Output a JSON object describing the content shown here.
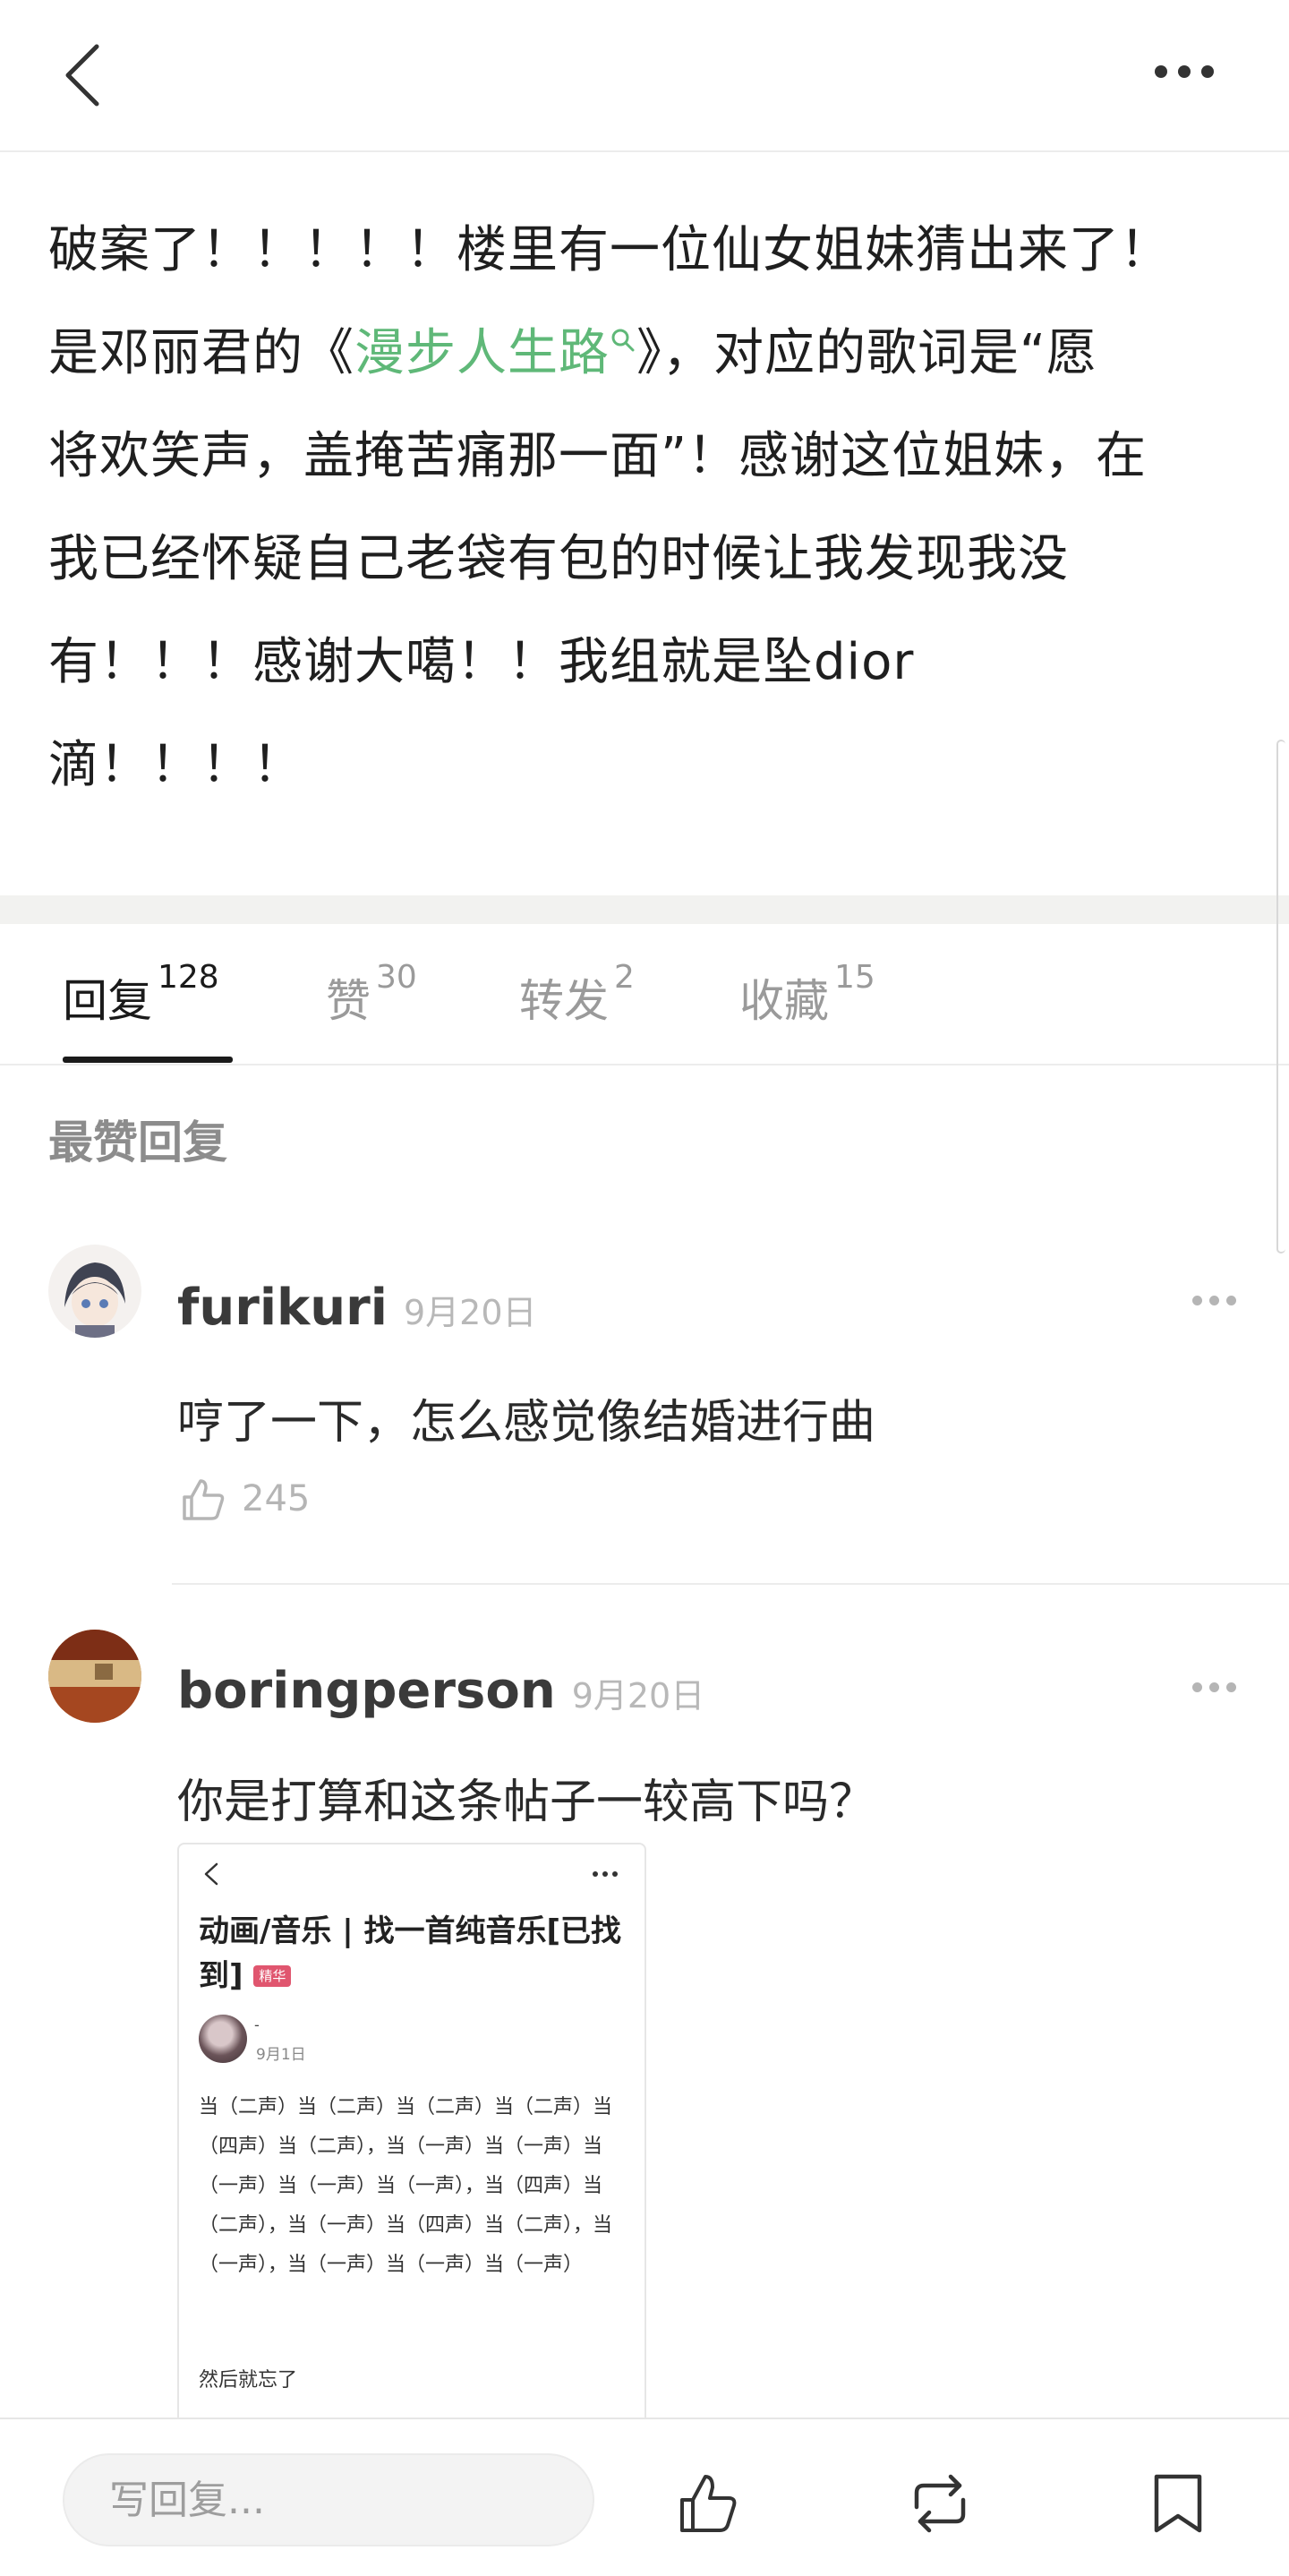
{
  "post": {
    "line1": "破案了！！！！！楼里有一位仙女姐妹猜出来了！",
    "line2_prefix": "是邓丽君的《",
    "line2_link": "漫步人生路",
    "line2_suffix": "》，对应的歌词是“愿",
    "line3": "将欢笑声，盖掩苦痛那一面”！感谢这位姐妹，在",
    "line4": "我已经怀疑自己老袋有包的时候让我发现我没",
    "line5": "有！！！感谢大噶！！我组就是坠dior",
    "line6": "滴！！！！"
  },
  "tabs": [
    {
      "label": "回复",
      "count": "128",
      "active": true
    },
    {
      "label": "赞",
      "count": "30"
    },
    {
      "label": "转发",
      "count": "2"
    },
    {
      "label": "收藏",
      "count": "15"
    }
  ],
  "section_title": "最赞回复",
  "replies": [
    {
      "username": "furikuri",
      "date": "9月20日",
      "text": "哼了一下，怎么感觉像结婚进行曲",
      "likes": "245"
    },
    {
      "username": "boringperson",
      "date": "9月20日",
      "text": "你是打算和这条帖子一较高下吗？"
    }
  ],
  "embed": {
    "title": "动画/音乐 | 找一首纯音乐[已找到]",
    "badge": "精华",
    "author": "-",
    "date": "9月1日",
    "body": "当（二声）当（二声）当（二声）当（二声）当（四声）当（二声），当（一声）当（一声）当（一声）当（一声）当（一声），当（四声）当（二声），当（一声）当（四声）当（二声），当（一声），当（一声）当（一声）当（一声）",
    "body2": "然后就忘了"
  },
  "bottom": {
    "reply_placeholder": "写回复..."
  },
  "colors": {
    "link": "#5fb878",
    "badge": "#e0566f"
  }
}
